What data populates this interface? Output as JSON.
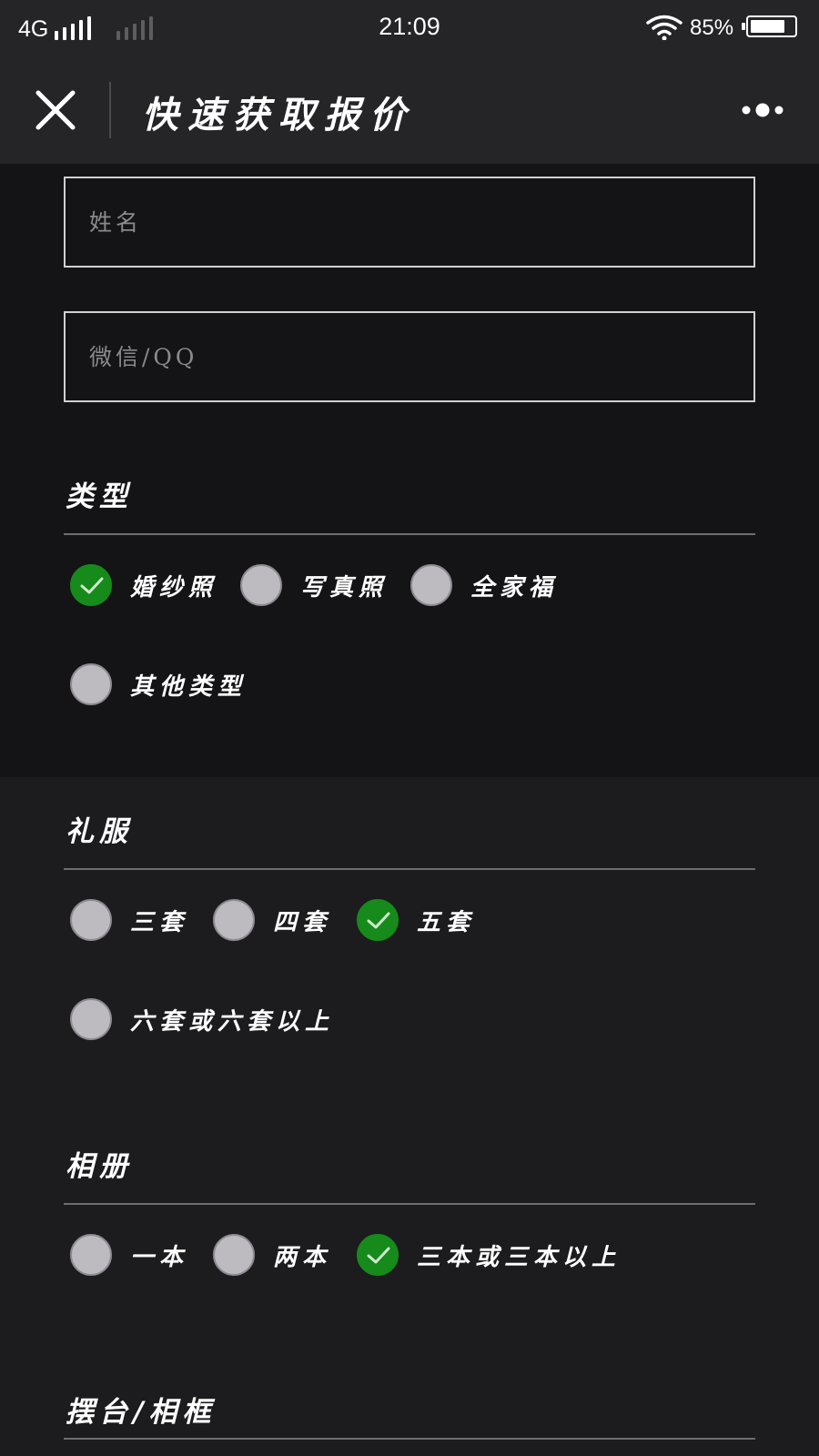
{
  "status_bar": {
    "network": "4G",
    "time": "21:09",
    "battery_percent": "85%",
    "battery_level": 0.85,
    "icons": [
      "signal-icon",
      "wifi-icon",
      "battery-icon"
    ]
  },
  "nav": {
    "title": "快速获取报价",
    "close_icon": "close-icon",
    "more_icon": "more-dots-icon"
  },
  "form": {
    "name_placeholder": "姓名",
    "contact_placeholder": "微信/QQ"
  },
  "type_group": {
    "title": "类型",
    "options": [
      {
        "label": "婚纱照",
        "checked": true
      },
      {
        "label": "写真照",
        "checked": false
      },
      {
        "label": "全家福",
        "checked": false
      },
      {
        "label": "其他类型",
        "checked": false
      }
    ]
  },
  "dress_group": {
    "title": "礼服",
    "options": [
      {
        "label": "三套",
        "checked": false
      },
      {
        "label": "四套",
        "checked": false
      },
      {
        "label": "五套",
        "checked": true
      },
      {
        "label": "六套或六套以上",
        "checked": false
      }
    ]
  },
  "album_group": {
    "title": "相册",
    "options": [
      {
        "label": "一本",
        "checked": false
      },
      {
        "label": "两本",
        "checked": false
      },
      {
        "label": "三本或三本以上",
        "checked": true
      }
    ]
  },
  "frame_group": {
    "title": "摆台/相框"
  },
  "colors": {
    "checked": "#168a1a",
    "unchecked": "#bdbbc0",
    "background": "#1c1b1d",
    "header": "#252427"
  }
}
